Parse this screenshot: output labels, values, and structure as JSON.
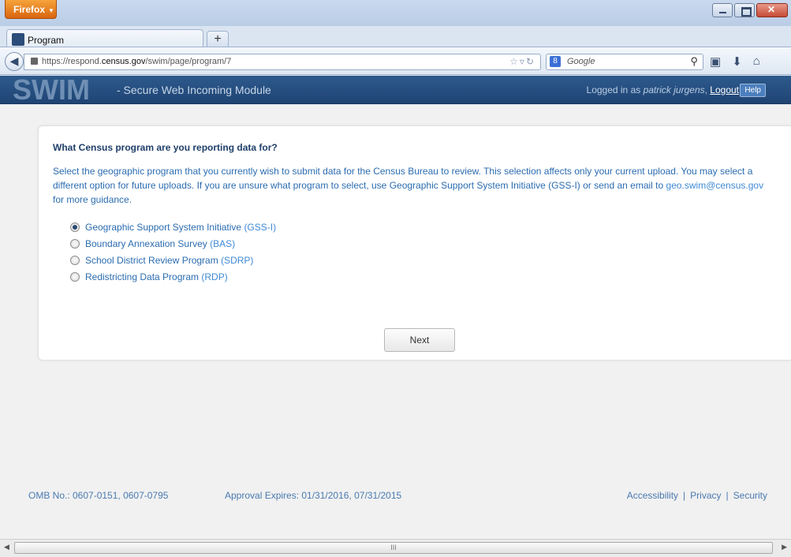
{
  "browser": {
    "menu_label": "Firefox",
    "tab_title": "Program",
    "new_tab": "+",
    "url_prefix": "https://respond.",
    "url_domain": "census.gov",
    "url_path": "/swim/page/program/7",
    "search_engine": "8",
    "search_placeholder": "Google",
    "icons": [
      "back-icon",
      "lock-icon",
      "star-icon",
      "reload-icon",
      "search-icon",
      "bookmarks-icon",
      "download-icon",
      "home-icon"
    ]
  },
  "header": {
    "logo": "SWIM",
    "subtitle": "- Secure Web Incoming Module",
    "logged_in_prefix": "Logged in as ",
    "user_name": "patrick jurgens",
    "logout": "Logout",
    "help": "Help"
  },
  "form": {
    "question": "What Census program are you reporting data for?",
    "desc_part1": "Select the geographic program that you currently wish to submit data for the Census Bureau to review. This selection affects only your current upload. You may select a different option for future uploads. If you are unsure what program to select, use Geographic Support System Initiative (GSS-I) or send an email to ",
    "email": "geo.swim@census.gov",
    "desc_part2": " for more guidance.",
    "options": [
      {
        "label": "Geographic Support System Initiative ",
        "abbr": "(GSS-I)",
        "selected": true
      },
      {
        "label": "Boundary Annexation Survey ",
        "abbr": "(BAS)",
        "selected": false
      },
      {
        "label": "School District Review Program ",
        "abbr": "(SDRP)",
        "selected": false
      },
      {
        "label": "Redistricting Data Program ",
        "abbr": "(RDP)",
        "selected": false
      }
    ],
    "next_label": "Next"
  },
  "footer": {
    "omb": "OMB No.: 0607-0151, 0607-0795",
    "approval": "Approval Expires: 01/31/2016, 07/31/2015",
    "accessibility": "Accessibility",
    "privacy": "Privacy",
    "security": "Security",
    "separator": "|"
  },
  "scrollbar": {
    "grip": "III"
  },
  "colors": {
    "header_bg": "#1f4474",
    "link": "#3f8ad6",
    "text_blue": "#2b6cb0",
    "firefox_orange": "#d9650f"
  }
}
